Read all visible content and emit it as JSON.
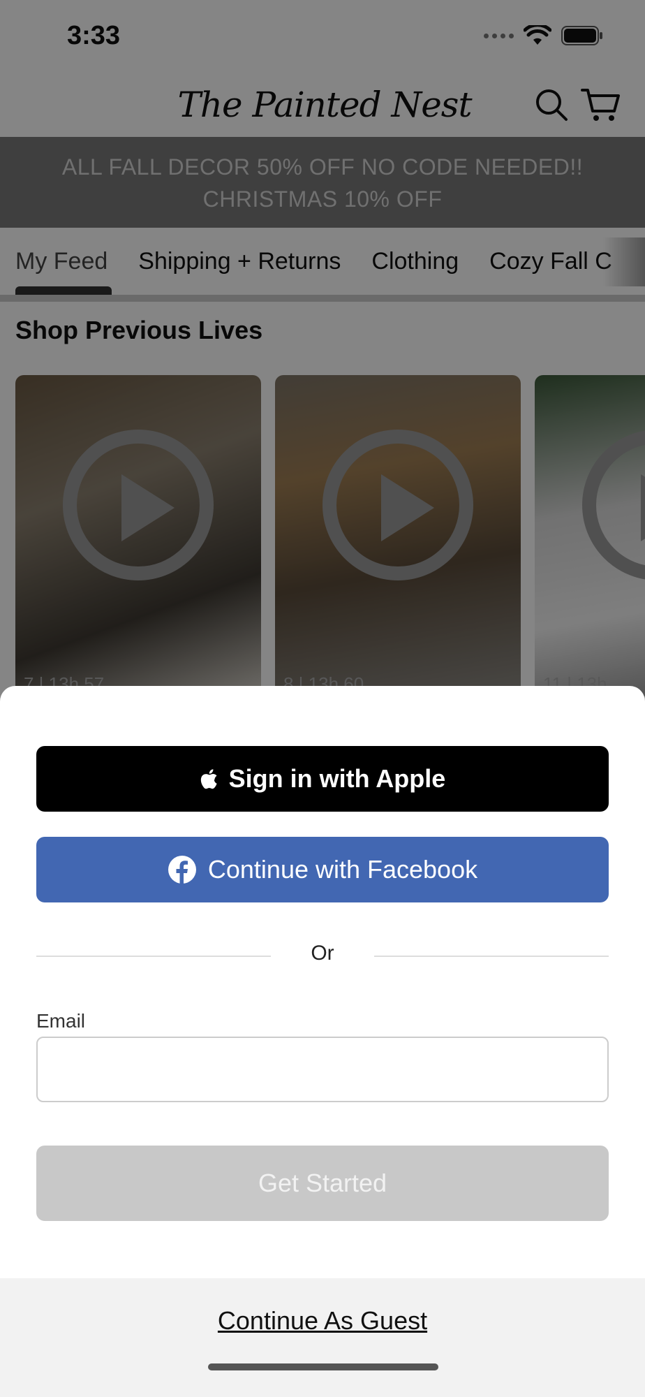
{
  "status_bar": {
    "time": "3:33"
  },
  "header": {
    "logo_text": "The Painted Nest",
    "search_icon": "search-icon",
    "cart_icon": "cart-icon"
  },
  "promo": {
    "line1": "ALL FALL DECOR 50% OFF NO CODE NEEDED!!",
    "line2": "CHRISTMAS 10% OFF"
  },
  "tabs": [
    {
      "label": "My Feed"
    },
    {
      "label": "Shipping + Returns"
    },
    {
      "label": "Clothing"
    },
    {
      "label": "Cozy Fall C"
    }
  ],
  "section": {
    "title": "Shop Previous Lives"
  },
  "cards": [
    {
      "meta_left": "7 | 13h",
      "meta_right": "57"
    },
    {
      "meta_left": "8 | 13h",
      "meta_right": "60"
    },
    {
      "meta_left": "11 | 13h",
      "meta_right": ""
    }
  ],
  "auth_sheet": {
    "apple_button": "Sign in with Apple",
    "facebook_button": "Continue with Facebook",
    "divider_text": "Or",
    "email_label": "Email",
    "email_value": "",
    "get_started_button": "Get Started",
    "guest_link": "Continue As Guest"
  },
  "colors": {
    "facebook_blue": "#4267b2",
    "apple_black": "#000000",
    "disabled_gray": "#c8c8c8"
  }
}
